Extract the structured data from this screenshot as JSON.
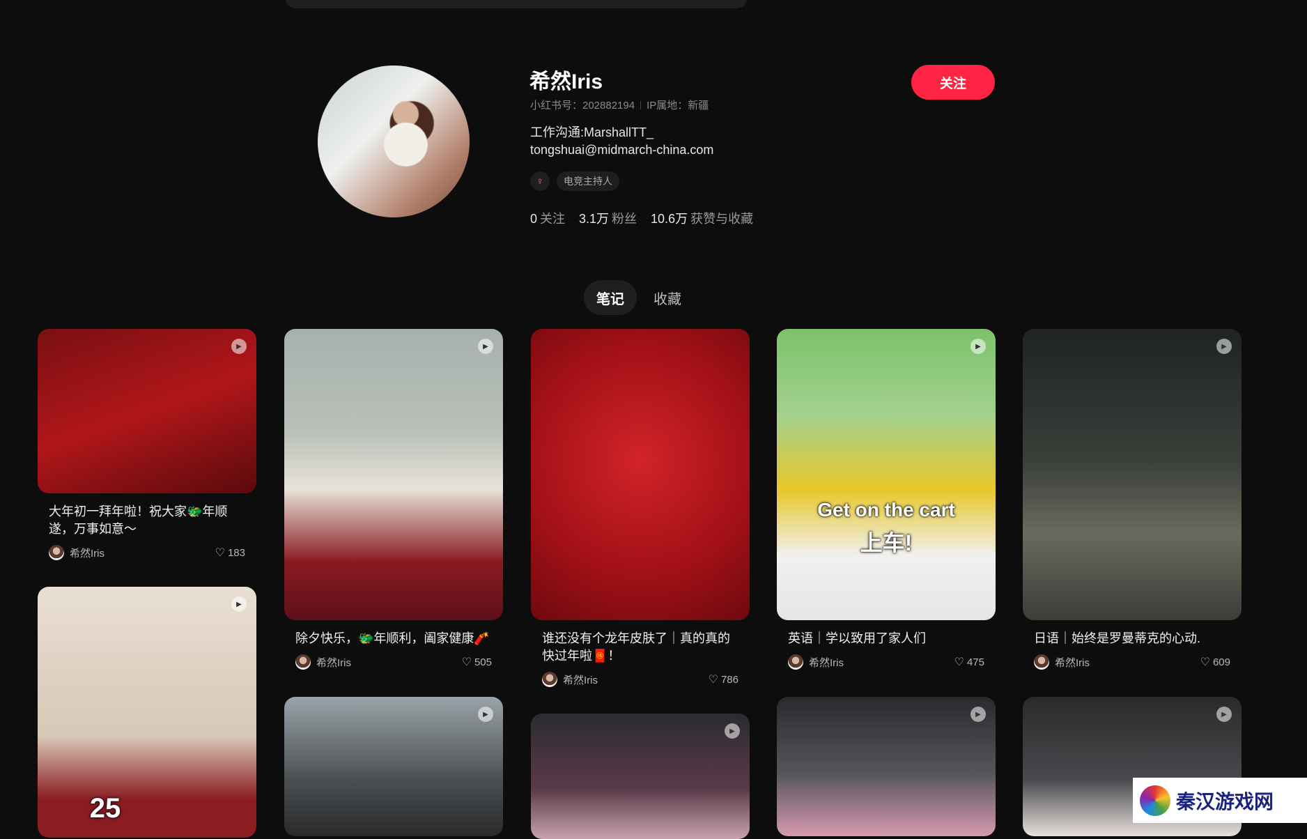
{
  "profile": {
    "name": "希然Iris",
    "xhs_id": "小红书号：202882194",
    "ip": "IP属地：新疆",
    "bio_line1": "工作沟通:MarshallTT_",
    "bio_line2": "tongshuai@midmarch-china.com",
    "gender_symbol": "♀",
    "tag": "电竞主持人",
    "follow_label": "关注",
    "stats": [
      {
        "num": "0",
        "label": "关注"
      },
      {
        "num": "3.1万",
        "label": "粉丝"
      },
      {
        "num": "10.6万",
        "label": "获赞与收藏"
      }
    ]
  },
  "tabs": [
    {
      "label": "笔记",
      "active": true
    },
    {
      "label": "收藏",
      "active": false
    }
  ],
  "cards": [
    {
      "title": "大年初一拜年啦！祝大家🐲年顺遂，万事如意～",
      "author": "希然Iris",
      "likes": "183",
      "colors": [
        "#7a0f12",
        "#c21d1d"
      ]
    },
    {
      "title": "除夕快乐，🐲年顺利，阖家健康🧨",
      "author": "希然Iris",
      "likes": "505",
      "colors": [
        "#9aa49a",
        "#7a1c22"
      ]
    },
    {
      "title": "谁还没有个龙年皮肤了｜真的真的快过年啦🧧！",
      "author": "希然Iris",
      "likes": "786",
      "colors": [
        "#c3131b",
        "#7c0d12"
      ]
    },
    {
      "title": "英语｜学以致用了家人们",
      "author": "希然Iris",
      "likes": "475",
      "colors": [
        "#7fc46a",
        "#e7c52c"
      ],
      "overlay1": "Get on the cart",
      "overlay2": "上车!"
    },
    {
      "title": "日语｜始终是罗曼蒂克的心动.",
      "author": "希然Iris",
      "likes": "609",
      "colors": [
        "#2b2e2a",
        "#1a1a1c"
      ]
    }
  ],
  "card_overlay_25": "25",
  "watermark": "秦汉游戏网",
  "play_icon": "▶",
  "heart_icon": "♡"
}
